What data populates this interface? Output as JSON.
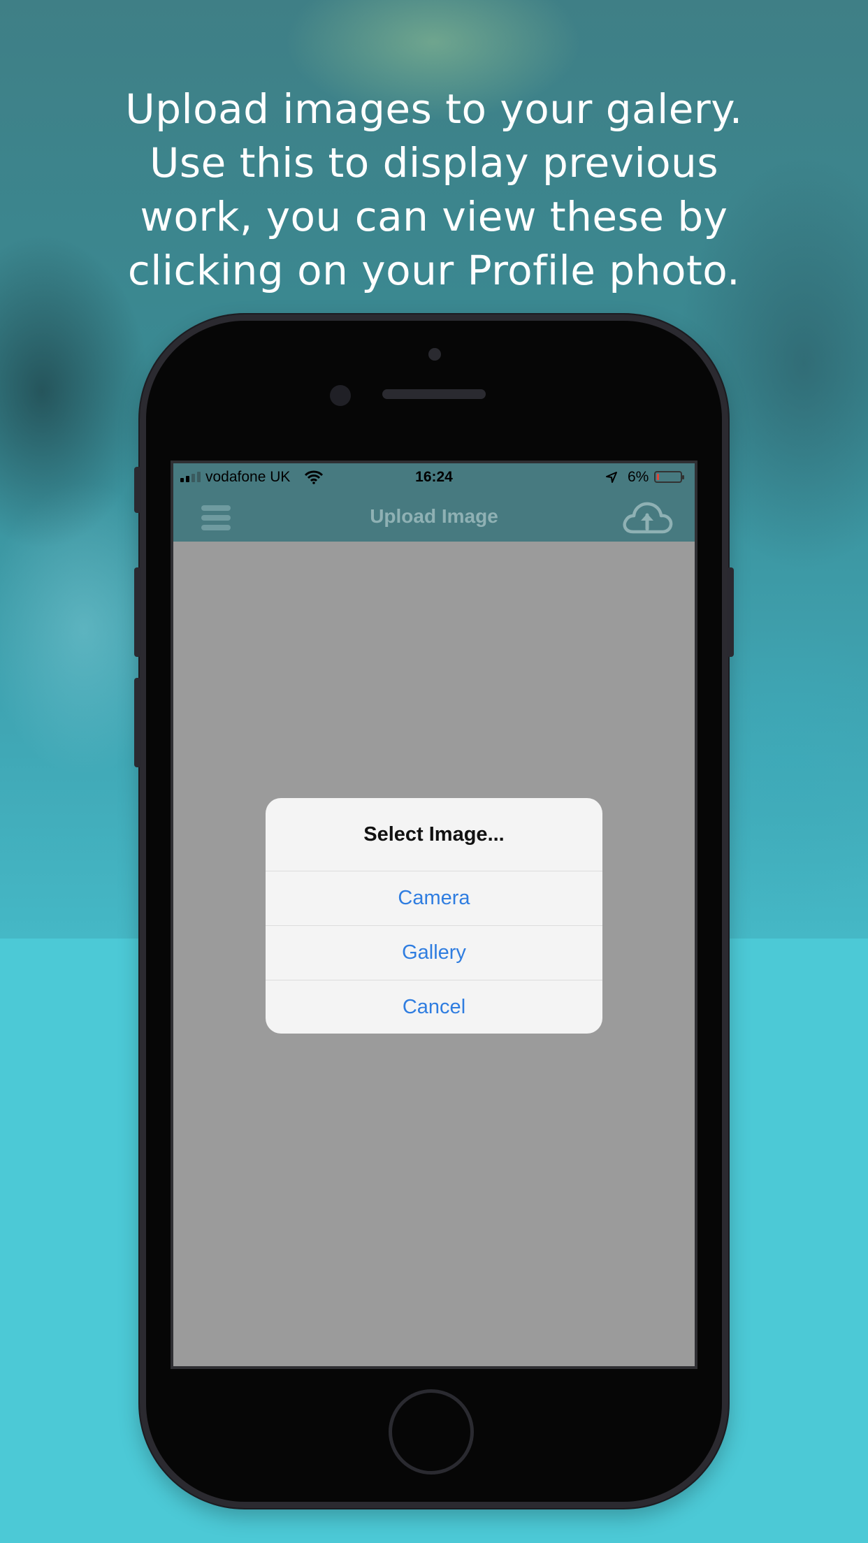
{
  "headline": {
    "lines": [
      "Upload images to your galery.",
      "Use this to display previous",
      "work, you can view these by",
      "clicking on your Profile photo."
    ]
  },
  "status_bar": {
    "carrier": "vodafone UK",
    "time": "16:24",
    "battery_percent": "6%",
    "battery_level": 0.06,
    "icons": [
      "signal-icon",
      "wifi-icon",
      "location-arrow-icon",
      "battery-icon"
    ]
  },
  "nav": {
    "title": "Upload Image",
    "menu_icon": "hamburger-menu-icon",
    "upload_icon": "cloud-upload-icon"
  },
  "dialog": {
    "title": "Select Image...",
    "options": [
      "Camera",
      "Gallery",
      "Cancel"
    ]
  },
  "colors": {
    "background_teal": "#4cc9d6",
    "nav_bar": "#477a80",
    "screen_overlay": "#9b9b9b",
    "action_blue": "#2f7de0",
    "phone_body": "#060606"
  }
}
